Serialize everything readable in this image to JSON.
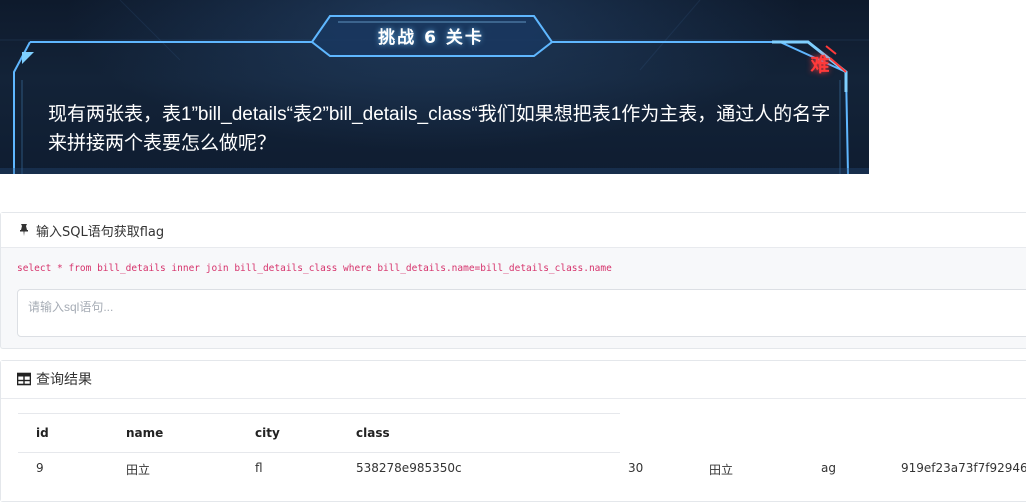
{
  "banner": {
    "title": "挑战 6 关卡",
    "difficulty": "难",
    "question": "现有两张表，表1”bill_details“表2”bill_details_class“我们如果想把表1作为主表，通过人的名字来拼接两个表要怎么做呢？"
  },
  "sql_panel": {
    "header": "输入SQL语句获取flag",
    "icon": "pin-icon",
    "hint": "select * from bill_details inner join bill_details_class where bill_details.name=bill_details_class.name",
    "input_value": "",
    "input_placeholder": "请输入sql语句..."
  },
  "results_panel": {
    "header": "查询结果",
    "icon": "table-icon",
    "columns": [
      "id",
      "name",
      "city",
      "class"
    ],
    "rows": [
      [
        "9",
        "田立",
        "fl",
        "538278e985350c",
        "30",
        "田立",
        "ag",
        "919ef23a73f7f92946"
      ]
    ]
  },
  "colors": {
    "banner_bg": "#132338",
    "frame": "#5fb7ff",
    "difficulty": "#ff3a3a",
    "sql_hint": "#d6336c"
  }
}
